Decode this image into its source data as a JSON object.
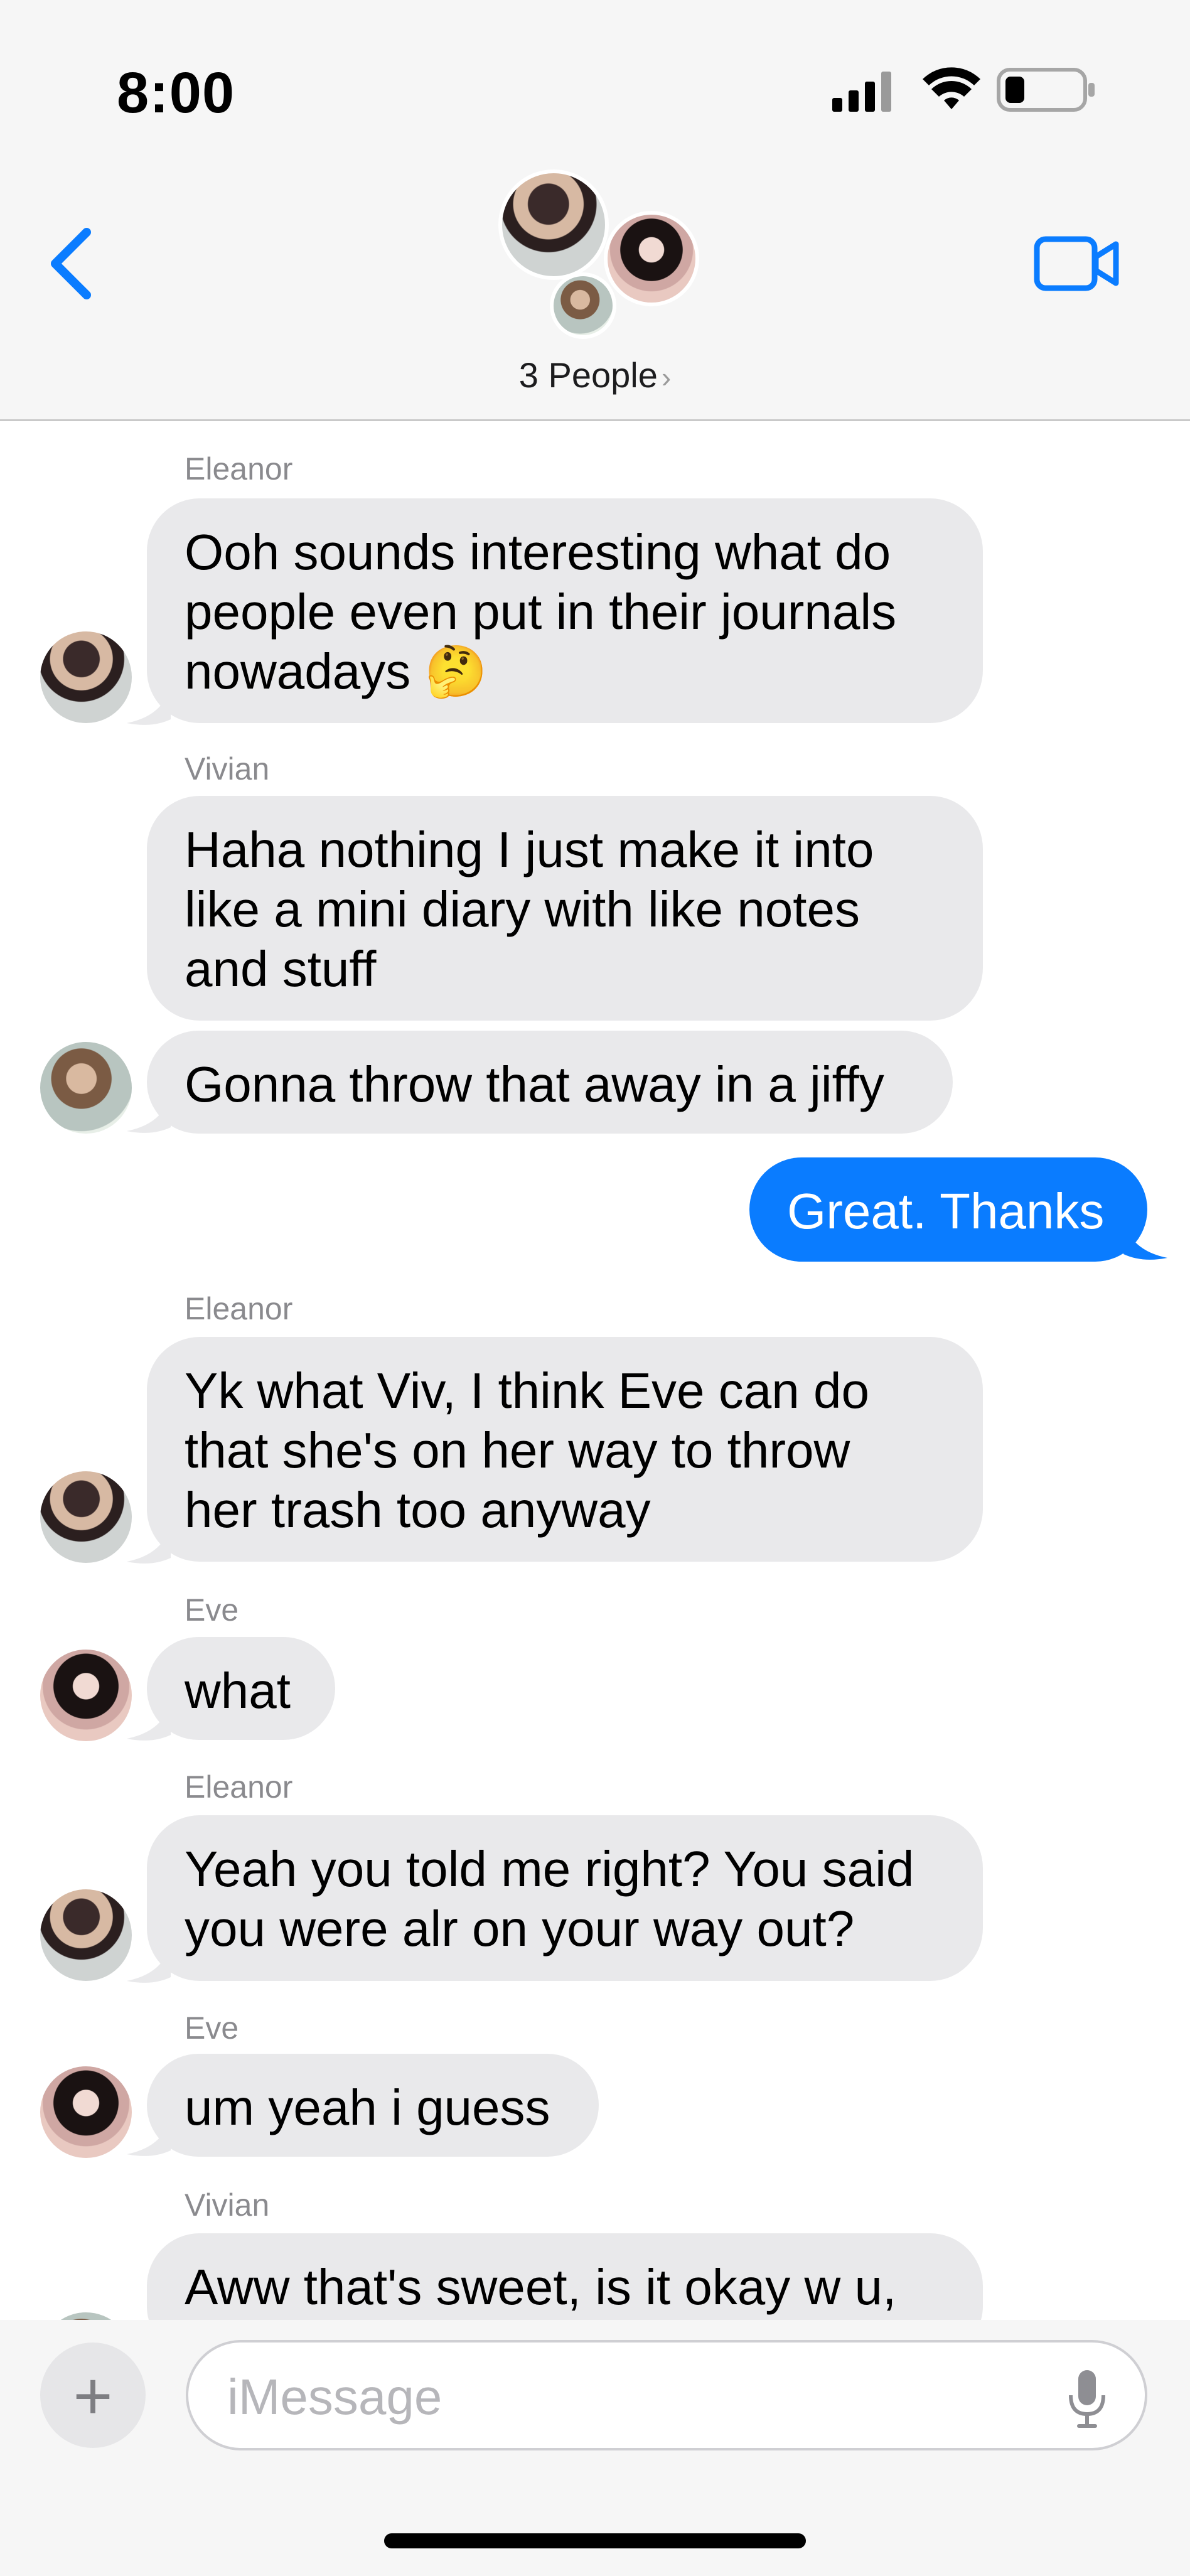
{
  "status_bar": {
    "time": "8:00"
  },
  "header": {
    "people_label": "3 People",
    "chevron": "›"
  },
  "messages": [
    {
      "sender": "Eleanor",
      "lines": [
        "Ooh sounds interesting what do",
        "people even put in their journals",
        "nowadays 🤔"
      ]
    },
    {
      "sender": "Vivian",
      "lines": [
        "Haha nothing I just make it into",
        "like a mini diary with like notes",
        "and stuff"
      ]
    },
    {
      "sender": "",
      "lines": [
        "Gonna throw that away in a jiffy"
      ]
    },
    {
      "sender": "Me",
      "lines": [
        "Great. Thanks"
      ]
    },
    {
      "sender": "Eleanor",
      "lines": [
        "Yk what Viv, I think Eve can do",
        "that she's on her way to throw",
        "her trash too anyway"
      ]
    },
    {
      "sender": "Eve",
      "lines": [
        "what"
      ]
    },
    {
      "sender": "Eleanor",
      "lines": [
        "Yeah you told me right? You said",
        "you were alr on your way out?"
      ]
    },
    {
      "sender": "Eve",
      "lines": [
        "um yeah i guess"
      ]
    },
    {
      "sender": "Vivian",
      "lines": [
        "Aww that's sweet, is it okay w u,"
      ]
    }
  ],
  "input": {
    "placeholder": "iMessage",
    "value": ""
  },
  "icons": {
    "back": "chevron-left-icon",
    "video": "video-camera-icon",
    "plus": "plus-icon",
    "mic": "microphone-icon"
  },
  "colors": {
    "accent": "#0a7cff",
    "incoming_bubble": "#e9e9eb",
    "header_bg": "#f6f6f6"
  }
}
